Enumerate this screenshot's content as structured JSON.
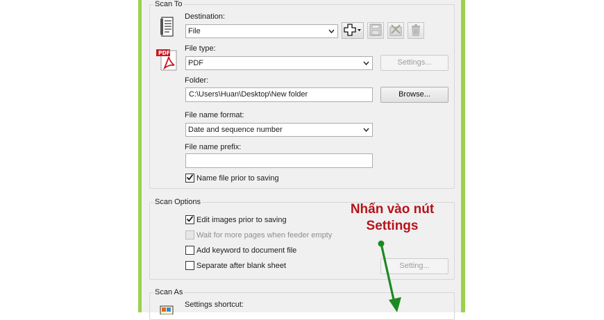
{
  "colors": {
    "frame_green": "#9ad24b",
    "annotation_red": "#b5141b",
    "arrow_green": "#1c8a22"
  },
  "scan_to": {
    "title": "Scan To",
    "destination_label": "Destination:",
    "destination_value": "File",
    "file_type_label": "File type:",
    "file_type_value": "PDF",
    "settings_button": "Settings...",
    "folder_label": "Folder:",
    "folder_value": "C:\\Users\\Huan\\Desktop\\New folder",
    "browse_button": "Browse...",
    "file_name_format_label": "File name format:",
    "file_name_format_value": "Date and sequence number",
    "file_name_prefix_label": "File name prefix:",
    "file_name_prefix_value": "",
    "name_prior_label": "Name file prior to saving",
    "name_prior_checked": true
  },
  "scan_options": {
    "title": "Scan Options",
    "edit_images_label": "Edit images prior to saving",
    "wait_pages_label": "Wait for more pages when feeder empty",
    "add_keyword_label": "Add keyword to document file",
    "separate_label": "Separate after blank sheet",
    "setting_button": "Setting..."
  },
  "scan_as": {
    "title": "Scan As",
    "settings_shortcut_label": "Settings shortcut:"
  },
  "annotation": {
    "line1": "Nhấn vào nút",
    "line2": "Settings"
  },
  "icons": {
    "document_scanner": "document-icon",
    "pdf": "pdf-icon",
    "add_destination": "plus-icon",
    "save": "save-icon",
    "edit": "tools-icon",
    "delete": "trash-icon",
    "shortcut": "shortcut-icon"
  }
}
